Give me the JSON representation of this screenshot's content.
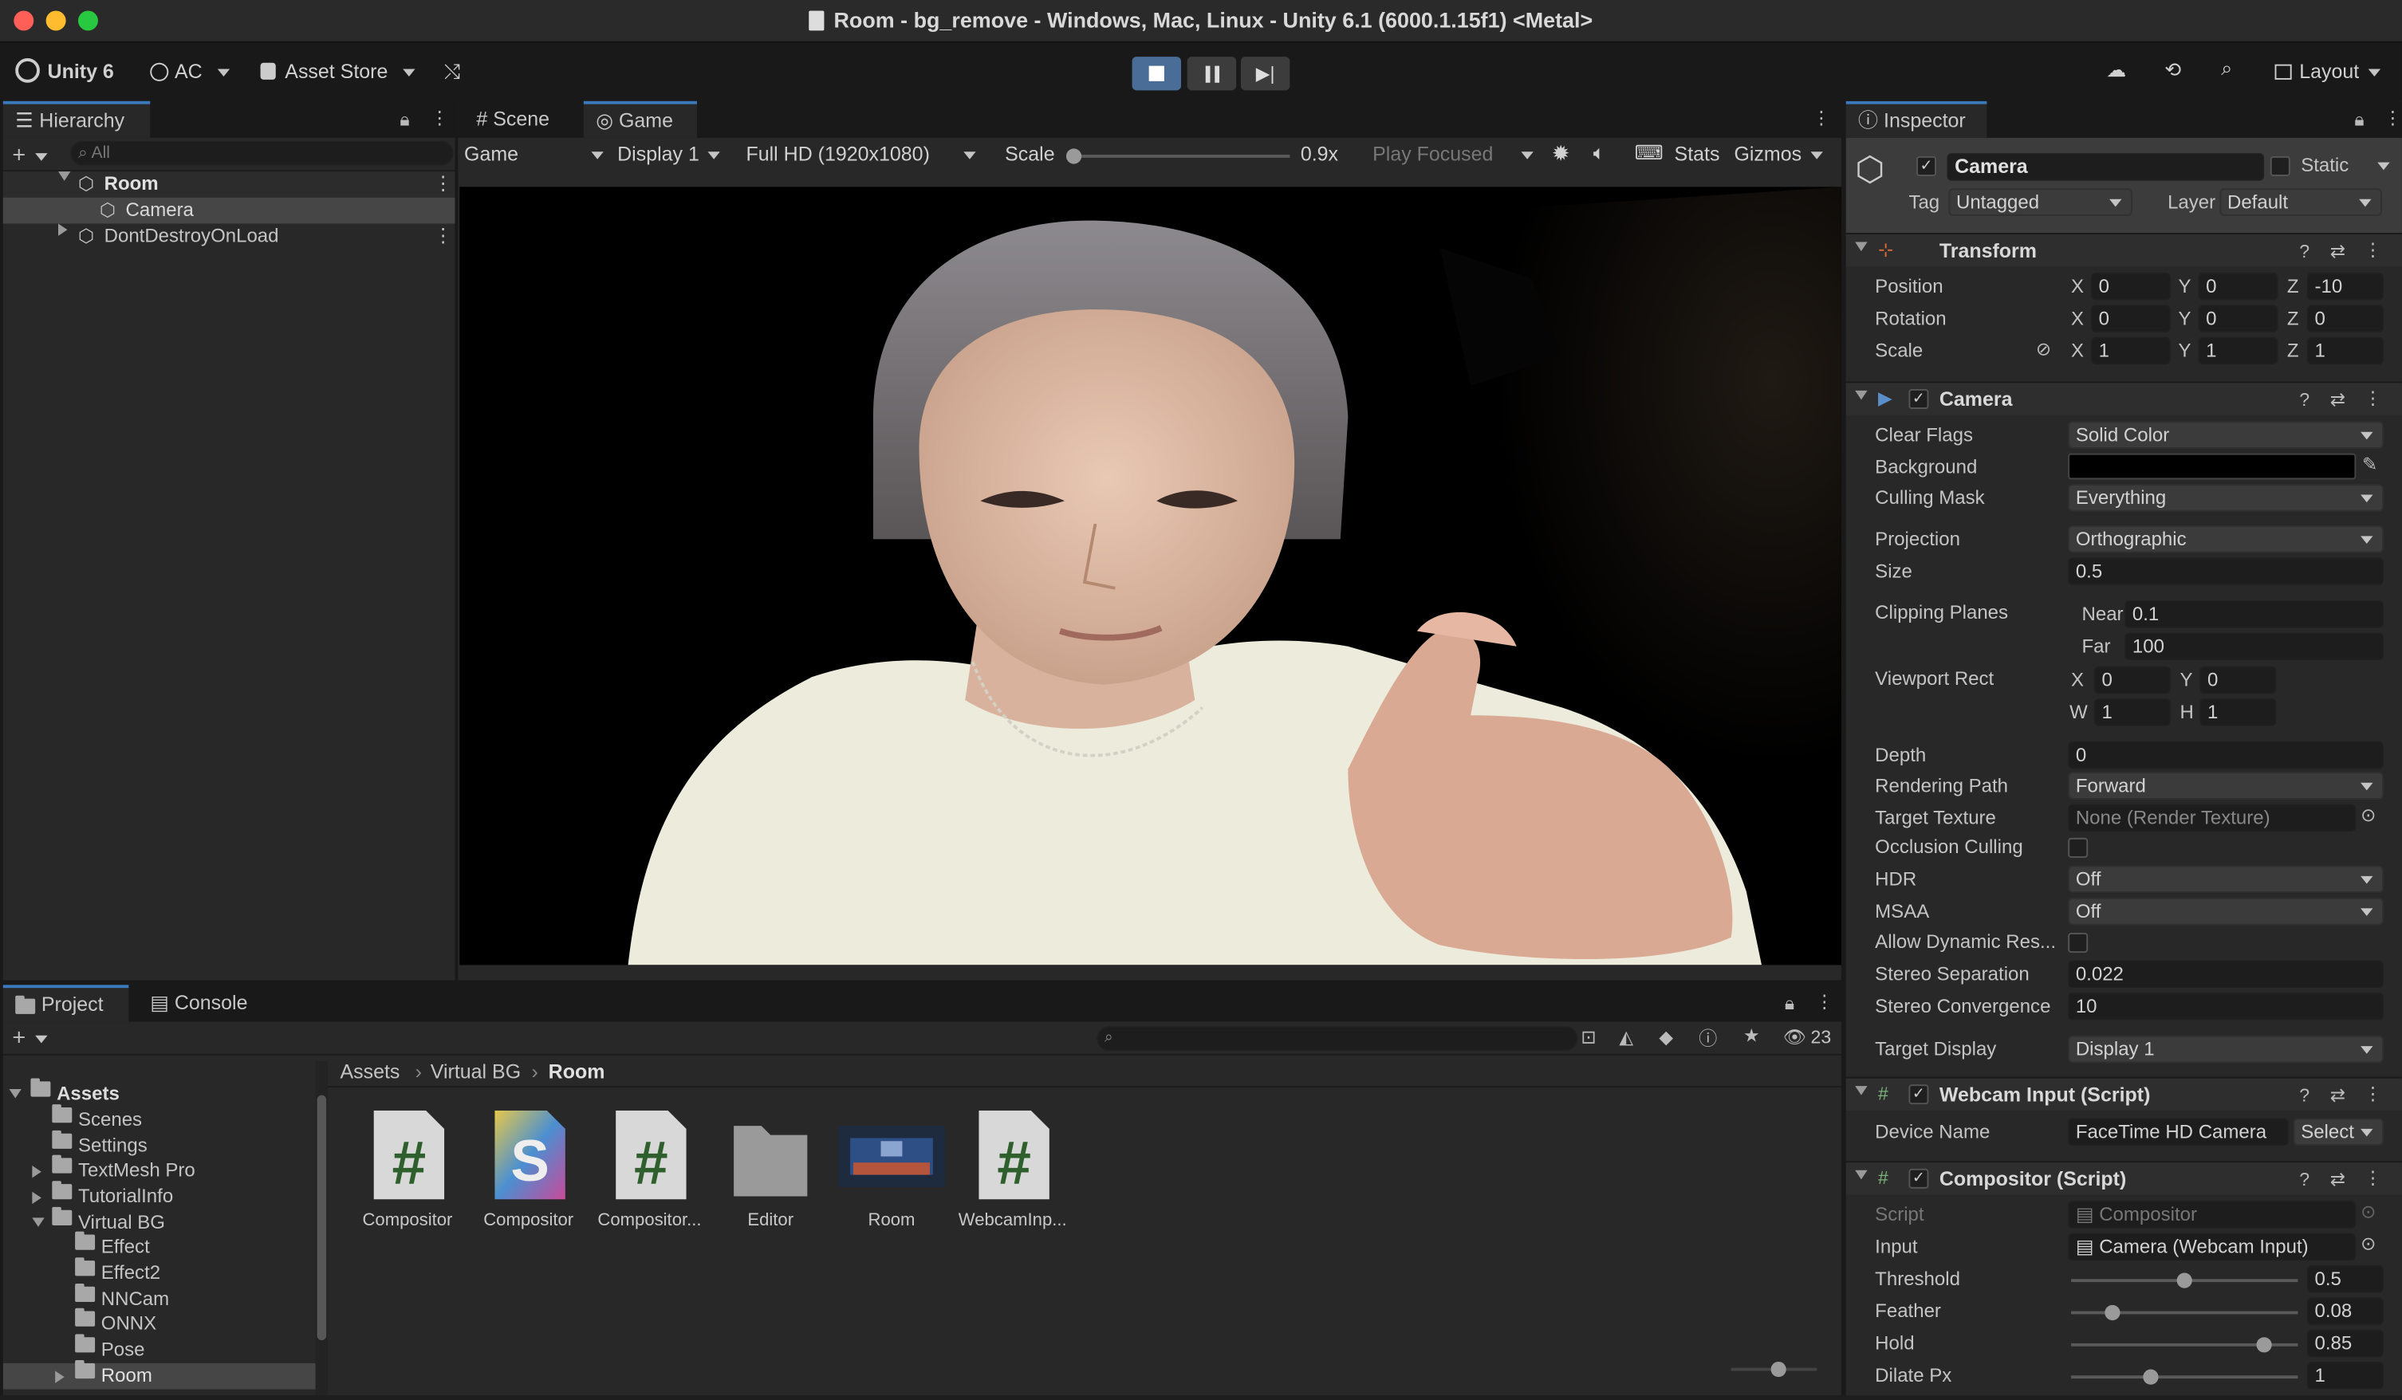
{
  "window": {
    "title": "Room - bg_remove - Windows, Mac, Linux - Unity 6.1 (6000.1.15f1) <Metal>"
  },
  "toolbar": {
    "unity_label": "Unity 6",
    "account_label": "AC",
    "asset_store_label": "Asset Store",
    "layout_label": "Layout"
  },
  "hierarchy": {
    "tab": "Hierarchy",
    "search_placeholder": "All",
    "items": [
      {
        "label": "Room"
      },
      {
        "label": "Camera"
      },
      {
        "label": "DontDestroyOnLoad"
      }
    ]
  },
  "game_view": {
    "tabs": [
      {
        "label": "Scene"
      },
      {
        "label": "Game"
      }
    ],
    "game_dropdown": "Game",
    "display_dropdown": "Display 1",
    "resolution_dropdown": "Full HD (1920x1080)",
    "scale_label": "Scale",
    "scale_value": "0.9x",
    "scale_fraction": 0.0,
    "play_focused": "Play Focused",
    "stats_label": "Stats",
    "gizmos_label": "Gizmos"
  },
  "project": {
    "tabs": [
      {
        "label": "Project"
      },
      {
        "label": "Console"
      }
    ],
    "item_count": "23",
    "breadcrumb": [
      "Assets",
      "Virtual BG",
      "Room"
    ],
    "tree": [
      {
        "label": "Assets"
      },
      {
        "label": "Scenes"
      },
      {
        "label": "Settings"
      },
      {
        "label": "TextMesh Pro"
      },
      {
        "label": "TutorialInfo"
      },
      {
        "label": "Virtual BG"
      },
      {
        "label": "Effect"
      },
      {
        "label": "Effect2"
      },
      {
        "label": "NNCam"
      },
      {
        "label": "ONNX"
      },
      {
        "label": "Pose"
      },
      {
        "label": "Room"
      }
    ],
    "assets": [
      {
        "label": "Compositor",
        "icon": "csharp-script-icon"
      },
      {
        "label": "Compositor",
        "icon": "shader-icon"
      },
      {
        "label": "Compositor...",
        "icon": "csharp-script-icon"
      },
      {
        "label": "Editor",
        "icon": "folder-icon"
      },
      {
        "label": "Room",
        "icon": "scene-thumbnail"
      },
      {
        "label": "WebcamInp...",
        "icon": "csharp-script-icon"
      }
    ]
  },
  "inspector": {
    "tab": "Inspector",
    "object_name": "Camera",
    "static_label": "Static",
    "tag_label": "Tag",
    "tag_value": "Untagged",
    "layer_label": "Layer",
    "layer_value": "Default",
    "transform": {
      "title": "Transform",
      "position_label": "Position",
      "position": {
        "x": "0",
        "y": "0",
        "z": "-10"
      },
      "rotation_label": "Rotation",
      "rotation": {
        "x": "0",
        "y": "0",
        "z": "0"
      },
      "scale_label": "Scale",
      "scale": {
        "x": "1",
        "y": "1",
        "z": "1"
      }
    },
    "camera": {
      "title": "Camera",
      "clear_flags_label": "Clear Flags",
      "clear_flags": "Solid Color",
      "background_label": "Background",
      "background_color": "#000000",
      "culling_mask_label": "Culling Mask",
      "culling_mask": "Everything",
      "projection_label": "Projection",
      "projection": "Orthographic",
      "size_label": "Size",
      "size": "0.5",
      "clipping_label": "Clipping Planes",
      "near_label": "Near",
      "near": "0.1",
      "far_label": "Far",
      "far": "100",
      "viewport_label": "Viewport Rect",
      "vx": "0",
      "vy": "0",
      "vw": "1",
      "vh": "1",
      "depth_label": "Depth",
      "depth": "0",
      "rendering_path_label": "Rendering Path",
      "rendering_path": "Forward",
      "target_texture_label": "Target Texture",
      "target_texture": "None (Render Texture)",
      "occlusion_label": "Occlusion Culling",
      "hdr_label": "HDR",
      "hdr": "Off",
      "msaa_label": "MSAA",
      "msaa": "Off",
      "dynamic_res_label": "Allow Dynamic Res...",
      "stereo_sep_label": "Stereo Separation",
      "stereo_sep": "0.022",
      "stereo_conv_label": "Stereo Convergence",
      "stereo_conv": "10",
      "target_display_label": "Target Display",
      "target_display": "Display 1"
    },
    "webcam": {
      "title": "Webcam Input (Script)",
      "device_label": "Device Name",
      "device": "FaceTime HD Camera",
      "select_label": "Select"
    },
    "compositor": {
      "title": "Compositor (Script)",
      "script_label": "Script",
      "script": "Compositor",
      "input_label": "Input",
      "input": "Camera (Webcam Input)",
      "threshold_label": "Threshold",
      "threshold": "0.5",
      "threshold_frac": 0.5,
      "feather_label": "Feather",
      "feather": "0.08",
      "feather_frac": 0.18,
      "hold_label": "Hold",
      "hold": "0.85",
      "hold_frac": 0.85,
      "dilate_label": "Dilate Px",
      "dilate": "1",
      "dilate_frac": 0.35
    }
  },
  "colors": {
    "accent": "#3a79bb",
    "panel": "#282828",
    "background": "#191919"
  }
}
